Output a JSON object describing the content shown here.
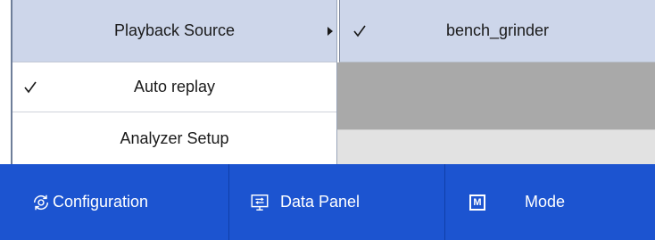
{
  "menu": {
    "items": [
      {
        "label": "Playback Source",
        "has_submenu": true,
        "checked": false
      },
      {
        "label": "Auto replay",
        "has_submenu": false,
        "checked": true
      },
      {
        "label": "Analyzer Setup",
        "has_submenu": false,
        "checked": false
      }
    ]
  },
  "submenu": {
    "items": [
      {
        "label": "bench_grinder",
        "checked": true
      }
    ]
  },
  "toolbar": {
    "configuration_label": "Configuration",
    "data_panel_label": "Data Panel",
    "mode_label": "Mode",
    "mode_icon_letter": "M"
  },
  "icons": {
    "configuration": "gear-cycle-icon",
    "data_panel": "monitor-transfer-icon",
    "mode": "mode-m-icon",
    "submenu_arrow": "caret-right-icon",
    "check": "checkmark-icon"
  },
  "colors": {
    "toolbar_bg": "#1c54d0",
    "menu_highlight": "#cdd6ea",
    "gray_panel": "#a9a9a9"
  }
}
